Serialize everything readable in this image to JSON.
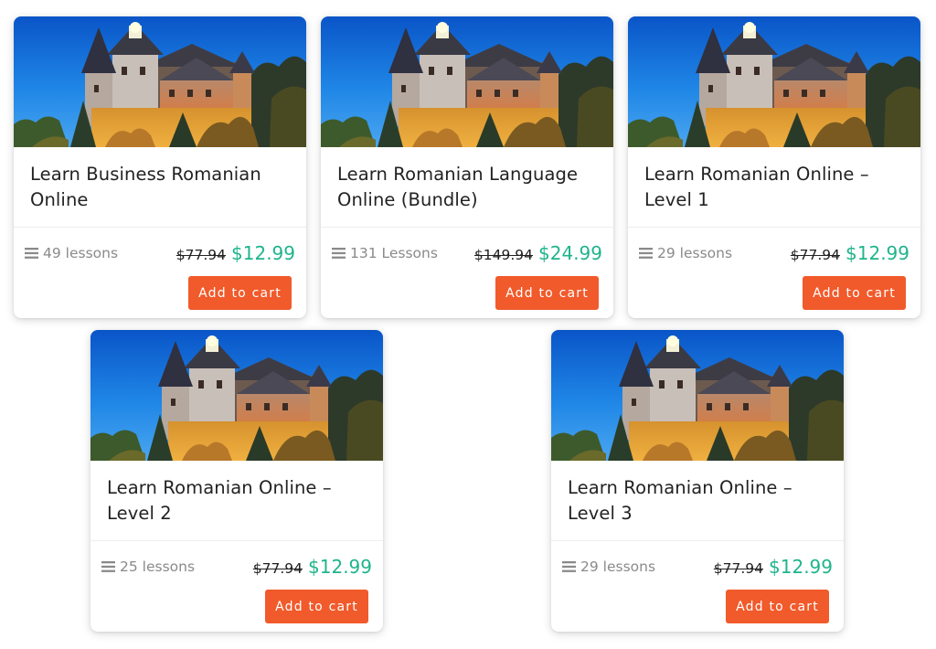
{
  "colors": {
    "accent_button": "#f15a2b",
    "sale_price": "#1fb48c",
    "muted_text": "#8a8a8a"
  },
  "courses": [
    {
      "title": "Learn Business Romanian Online",
      "lessons": "49 lessons",
      "old_price": "$77.94",
      "new_price": "$12.99",
      "button": "Add to cart",
      "image": "castle-photo"
    },
    {
      "title": "Learn Romanian Language Online (Bundle)",
      "lessons": "131 Lessons",
      "old_price": "$149.94",
      "new_price": "$24.99",
      "button": "Add to cart",
      "image": "castle-photo"
    },
    {
      "title": "Learn Romanian Online – Level 1",
      "lessons": "29 lessons",
      "old_price": "$77.94",
      "new_price": "$12.99",
      "button": "Add to cart",
      "image": "castle-photo"
    },
    {
      "title": "Learn Romanian Online – Level 2",
      "lessons": "25 lessons",
      "old_price": "$77.94",
      "new_price": "$12.99",
      "button": "Add to cart",
      "image": "castle-photo"
    },
    {
      "title": "Learn Romanian Online – Level 3",
      "lessons": "29 lessons",
      "old_price": "$77.94",
      "new_price": "$12.99",
      "button": "Add to cart",
      "image": "castle-photo"
    }
  ]
}
